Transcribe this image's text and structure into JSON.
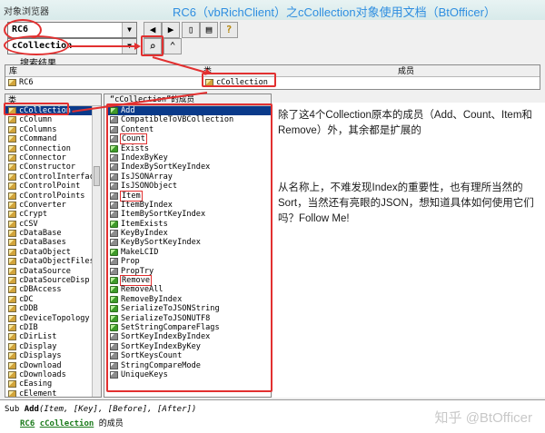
{
  "window": {
    "app_title": "对象浏览器",
    "doc_title": "RC6（vbRichClient）之cCollection对象使用文档（BtOfficer）"
  },
  "toolbar": {
    "library_value": "RC6",
    "search_value": "cCollection",
    "copy_glyph": "▯",
    "view_def_glyph": "▤",
    "help_glyph": "?"
  },
  "search_results": {
    "label": "搜索结果",
    "columns": [
      "库",
      "类",
      "成员"
    ],
    "row": {
      "library": "RC6",
      "class": "cCollection",
      "member": ""
    }
  },
  "classes": {
    "header": "类",
    "items": [
      "cCollection",
      "cColumn",
      "cColumns",
      "cCommand",
      "cConnection",
      "cConnector",
      "cConstructor",
      "cControlInterface",
      "cControlPoint",
      "cControlPoints",
      "cConverter",
      "cCrypt",
      "cCSV",
      "cDataBase",
      "cDataBases",
      "cDataObject",
      "cDataObjectFiles",
      "cDataSource",
      "cDataSourceDisp",
      "cDBAccess",
      "cDC",
      "cDDB",
      "cDeviceTopology",
      "cDIB",
      "cDirList",
      "cDisplay",
      "cDisplays",
      "cDownload",
      "cDownloads",
      "cEasing",
      "cElement"
    ]
  },
  "members": {
    "header": "“cCollection”的成员",
    "items": [
      {
        "name": "Add",
        "kind": "method"
      },
      {
        "name": "CompatibleToVBCollection",
        "kind": "prop"
      },
      {
        "name": "Content",
        "kind": "prop"
      },
      {
        "name": "Count",
        "kind": "prop"
      },
      {
        "name": "Exists",
        "kind": "method"
      },
      {
        "name": "IndexByKey",
        "kind": "prop"
      },
      {
        "name": "IndexBySortKeyIndex",
        "kind": "prop"
      },
      {
        "name": "IsJSONArray",
        "kind": "prop"
      },
      {
        "name": "IsJSONObject",
        "kind": "prop"
      },
      {
        "name": "Item",
        "kind": "prop"
      },
      {
        "name": "ItemByIndex",
        "kind": "prop"
      },
      {
        "name": "ItemBySortKeyIndex",
        "kind": "prop"
      },
      {
        "name": "ItemExists",
        "kind": "method"
      },
      {
        "name": "KeyByIndex",
        "kind": "prop"
      },
      {
        "name": "KeyBySortKeyIndex",
        "kind": "prop"
      },
      {
        "name": "MakeLCID",
        "kind": "method"
      },
      {
        "name": "Prop",
        "kind": "prop"
      },
      {
        "name": "PropTry",
        "kind": "prop"
      },
      {
        "name": "Remove",
        "kind": "method"
      },
      {
        "name": "RemoveAll",
        "kind": "method"
      },
      {
        "name": "RemoveByIndex",
        "kind": "method"
      },
      {
        "name": "SerializeToJSONString",
        "kind": "method"
      },
      {
        "name": "SerializeToJSONUTF8",
        "kind": "method"
      },
      {
        "name": "SetStringCompareFlags",
        "kind": "method"
      },
      {
        "name": "SortKeyIndexByIndex",
        "kind": "prop"
      },
      {
        "name": "SortKeyIndexByKey",
        "kind": "prop"
      },
      {
        "name": "SortKeysCount",
        "kind": "prop"
      },
      {
        "name": "StringCompareMode",
        "kind": "prop"
      },
      {
        "name": "UniqueKeys",
        "kind": "prop"
      }
    ]
  },
  "annotations": {
    "note1": "除了这4个Collection原本的成员（Add、Count、Item和Remove）外，其余都是扩展的",
    "note2": "从名称上，不难发现Index的重要性，也有理所当然的Sort，当然还有亮眼的JSON，想知道具体如何使用它们吗？Follow Me!"
  },
  "status": {
    "sub_kw": "Sub",
    "member_name": "Add",
    "params": "(Item, [Key], [Before], [After])",
    "lib_link": "RC6",
    "class_link": "cCollection",
    "suffix": "的成员"
  },
  "watermark": "知乎 @BtOfficer",
  "colors": {
    "accent_red": "#e23030",
    "title_blue": "#2f8ee0",
    "link_green": "#1a7a1a",
    "selection": "#0a3a8a"
  }
}
